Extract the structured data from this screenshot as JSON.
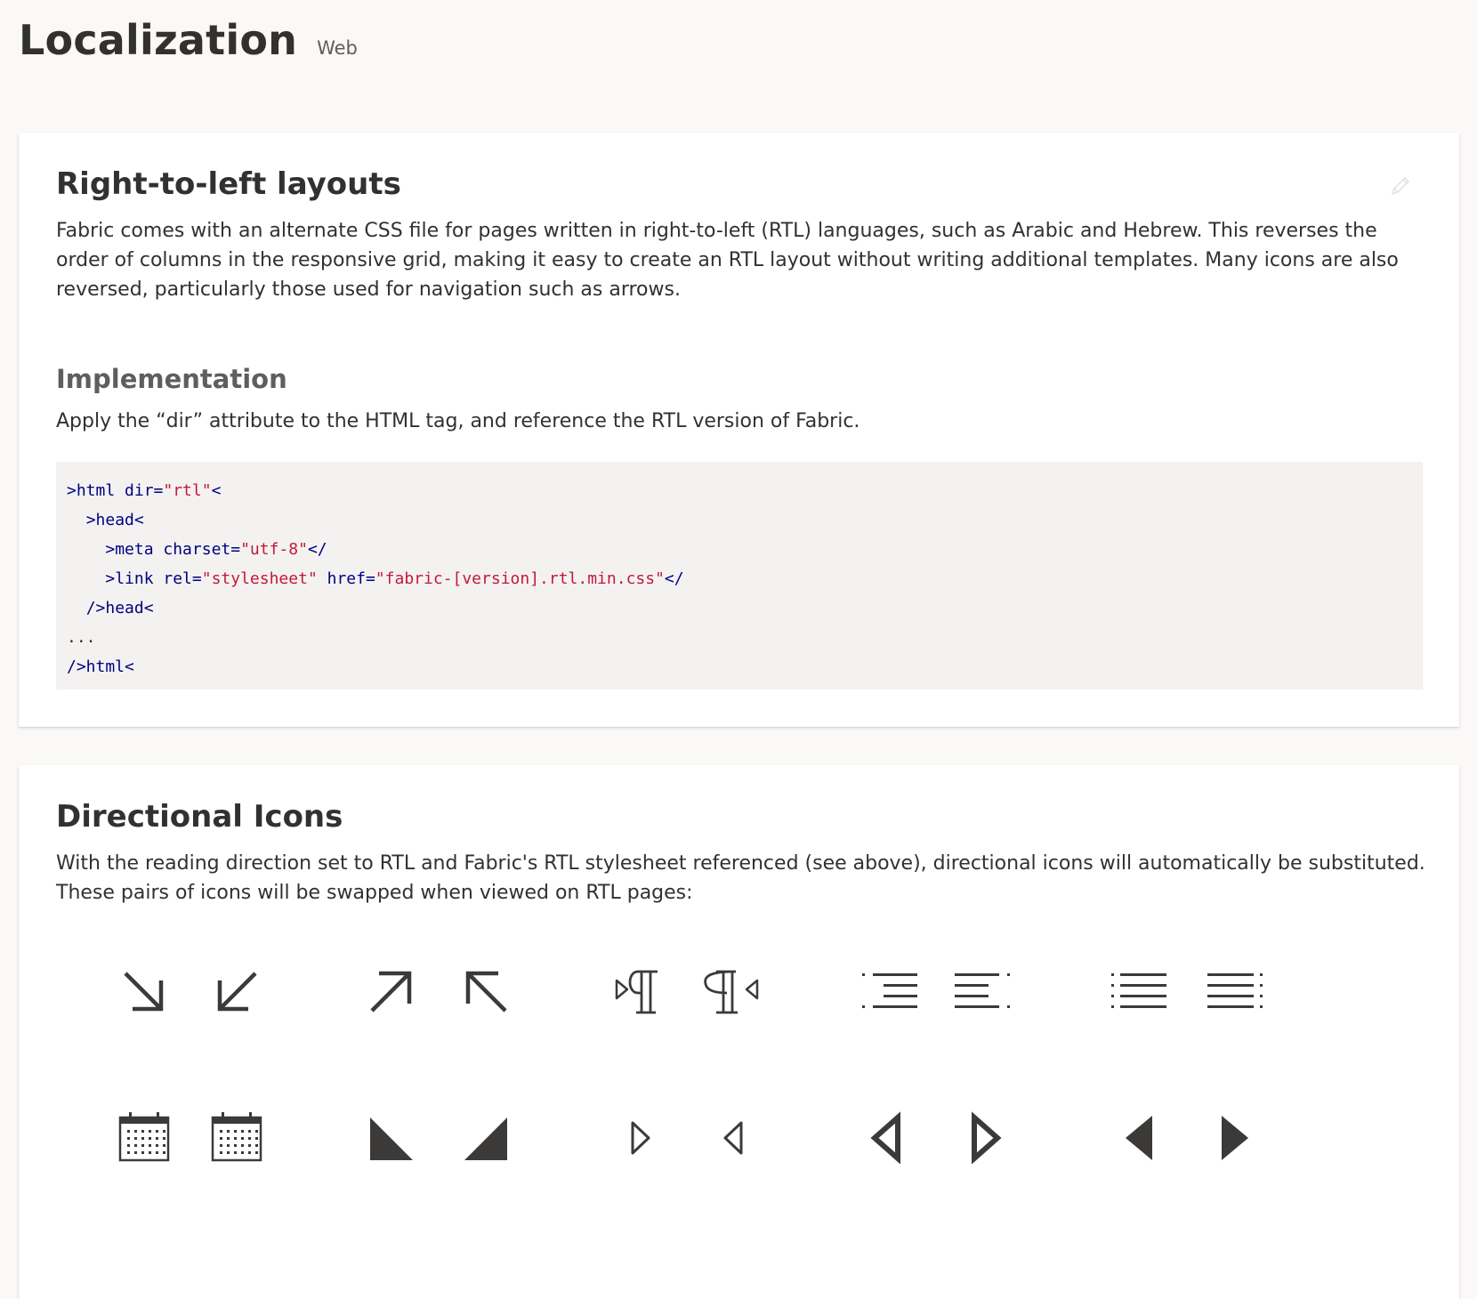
{
  "header": {
    "title": "Localization",
    "platform": "Web"
  },
  "rtl_section": {
    "title": "Right-to-left layouts",
    "description": "Fabric comes with an alternate CSS file for pages written in right-to-left (RTL) languages, such as Arabic and Hebrew. This reverses the order of columns in the responsive grid, making it easy to create an RTL layout without writing additional templates. Many icons are also reversed, particularly those used for navigation such as arrows.",
    "edit_icon": "edit-pencil-icon",
    "implementation": {
      "title": "Implementation",
      "description": "Apply the “dir” attribute to the HTML tag, and reference the RTL version of Fabric.",
      "code_lines": [
        {
          "indent": "",
          "parts": [
            {
              "t": "tag",
              "v": ">html dir="
            },
            {
              "t": "str",
              "v": "\"rtl\""
            },
            {
              "t": "tag",
              "v": "<"
            }
          ]
        },
        {
          "indent": "  ",
          "parts": [
            {
              "t": "tag",
              "v": ">head<"
            }
          ]
        },
        {
          "indent": "    ",
          "parts": [
            {
              "t": "tag",
              "v": ">meta charset="
            },
            {
              "t": "str",
              "v": "\"utf-8\""
            },
            {
              "t": "tag",
              "v": "</"
            }
          ]
        },
        {
          "indent": "    ",
          "parts": [
            {
              "t": "tag",
              "v": ">link rel="
            },
            {
              "t": "str",
              "v": "\"stylesheet\""
            },
            {
              "t": "tag",
              "v": " href="
            },
            {
              "t": "str",
              "v": "\"fabric-[version].rtl.min.css\""
            },
            {
              "t": "tag",
              "v": "</"
            }
          ]
        },
        {
          "indent": "  ",
          "parts": [
            {
              "t": "tag",
              "v": "/>head<"
            }
          ]
        },
        {
          "indent": "",
          "parts": [
            {
              "t": "plain",
              "v": "..."
            }
          ]
        },
        {
          "indent": "",
          "parts": [
            {
              "t": "tag",
              "v": "/>html<"
            }
          ]
        }
      ]
    }
  },
  "icons_section": {
    "title": "Directional Icons",
    "description": "With the reading direction set to RTL and Fabric's RTL stylesheet referenced (see above), directional icons will automatically be substituted. These pairs of icons will be swapped when viewed on RTL pages:",
    "pairs": [
      [
        "arrow-down-right-icon",
        "arrow-down-left-icon"
      ],
      [
        "arrow-up-right-icon",
        "arrow-up-left-icon"
      ],
      [
        "paragraph-ltr-icon",
        "paragraph-rtl-icon"
      ],
      [
        "align-right-icon",
        "align-left-icon"
      ],
      [
        "justify-right-icon",
        "justify-left-icon"
      ],
      [
        "calendar-ltr-icon",
        "calendar-rtl-icon"
      ],
      [
        "triangle-corner-left-icon",
        "triangle-corner-right-icon"
      ],
      [
        "caret-right-outline-icon",
        "caret-left-outline-icon"
      ],
      [
        "caret-left-bold-outline-icon",
        "caret-right-bold-outline-icon"
      ],
      [
        "caret-left-solid-icon",
        "caret-right-solid-icon"
      ]
    ],
    "icon_color": "#3b3a39"
  }
}
